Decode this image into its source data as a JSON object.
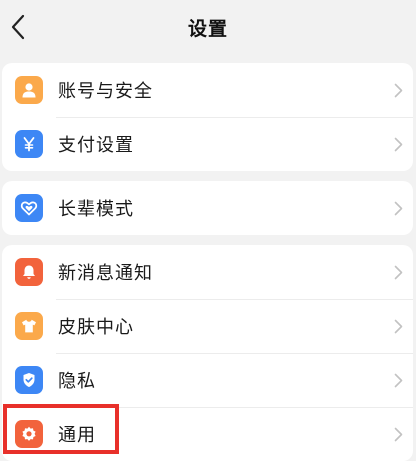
{
  "navbar": {
    "title": "设置"
  },
  "groups": [
    {
      "items": [
        {
          "label": "账号与安全",
          "icon": "person-icon",
          "icon_color": "#fba94b"
        },
        {
          "label": "支付设置",
          "icon": "yen-icon",
          "icon_color": "#3d87f5"
        }
      ]
    },
    {
      "items": [
        {
          "label": "长辈模式",
          "icon": "heart-shield-icon",
          "icon_color": "#3d87f5"
        }
      ]
    },
    {
      "items": [
        {
          "label": "新消息通知",
          "icon": "bell-icon",
          "icon_color": "#f2633c"
        },
        {
          "label": "皮肤中心",
          "icon": "tshirt-icon",
          "icon_color": "#fba94b"
        },
        {
          "label": "隐私",
          "icon": "shield-check-icon",
          "icon_color": "#3d87f5"
        },
        {
          "label": "通用",
          "icon": "gear-icon",
          "icon_color": "#f2633c"
        }
      ]
    }
  ],
  "highlight_color": "#e8302a"
}
